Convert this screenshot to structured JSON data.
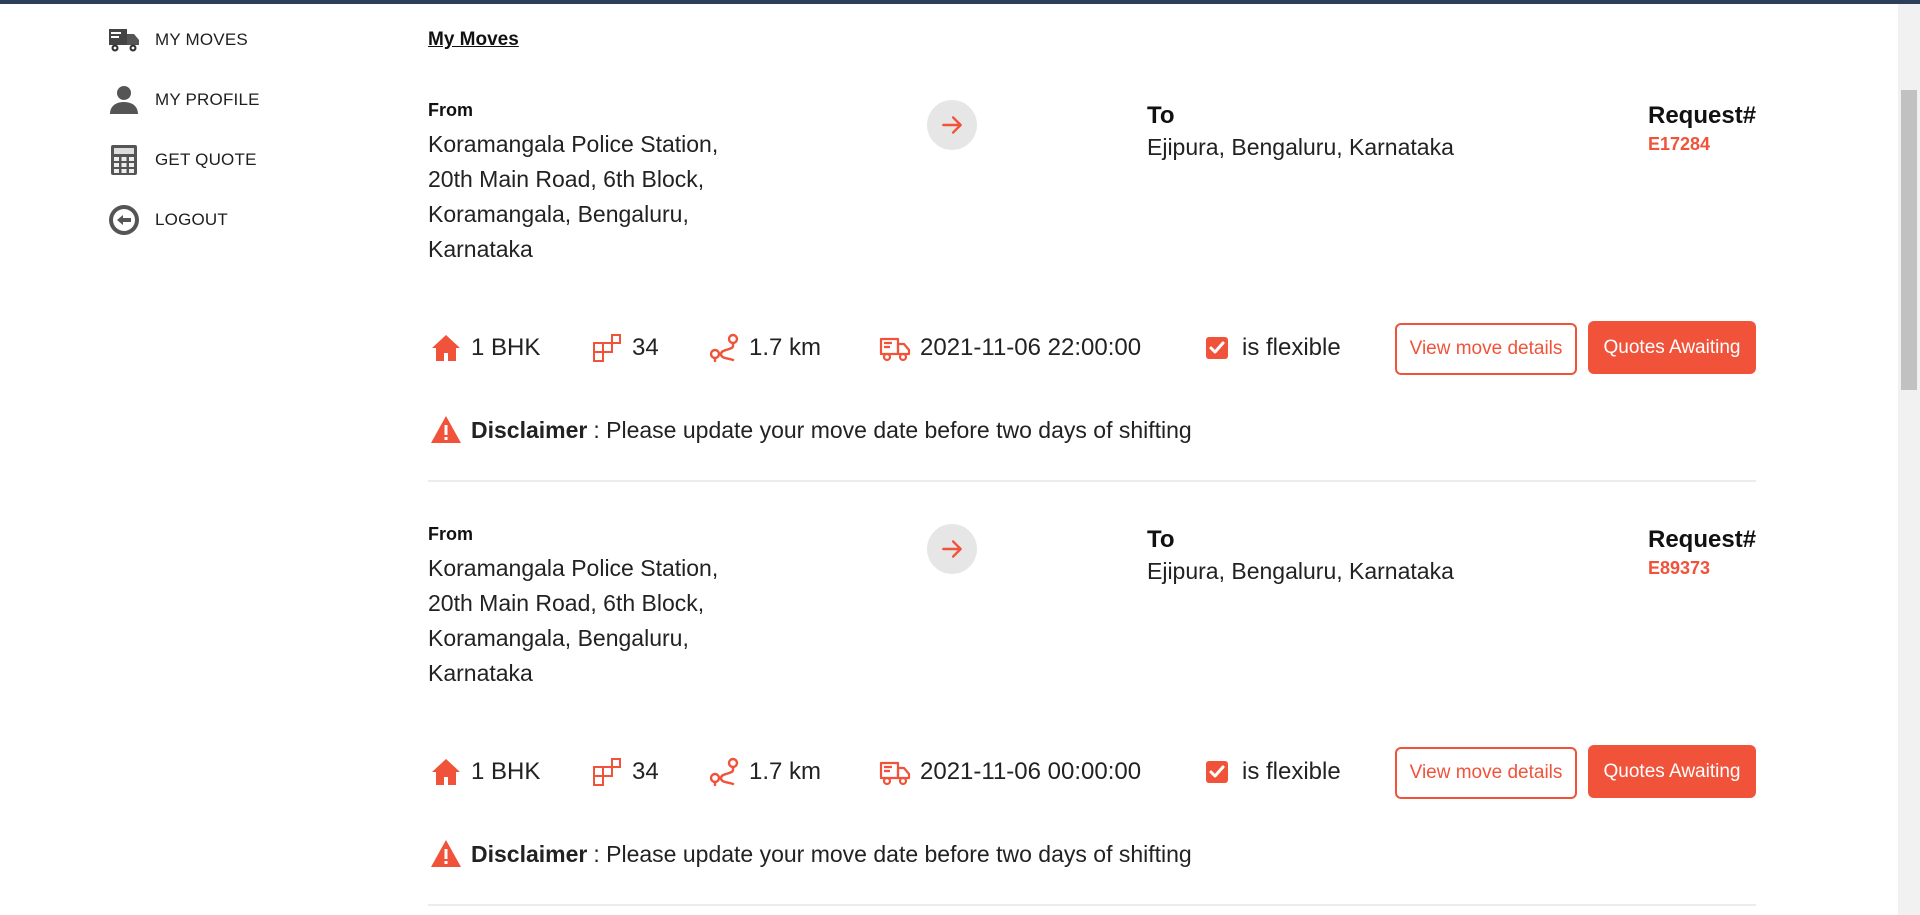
{
  "sidebar": {
    "items": [
      {
        "label": "MY MOVES",
        "icon": "truck-icon"
      },
      {
        "label": "MY PROFILE",
        "icon": "user-icon"
      },
      {
        "label": "GET QUOTE",
        "icon": "calculator-icon"
      },
      {
        "label": "LOGOUT",
        "icon": "logout-icon"
      }
    ]
  },
  "main": {
    "title": "My Moves",
    "moves": [
      {
        "from_label": "From",
        "from_address": [
          "Koramangala Police Station,",
          "20th Main Road, 6th Block,",
          "Koramangala, Bengaluru,",
          "Karnataka"
        ],
        "to_label": "To",
        "to_address": "Ejipura, Bengaluru, Karnataka",
        "request_label": "Request#",
        "request_id": "E17284",
        "house_type": "1 BHK",
        "items_count": "34",
        "distance": "1.7 km",
        "move_datetime": "2021-11-06 22:00:00",
        "flexible_label": "is flexible",
        "view_button": "View move details",
        "status_button": "Quotes Awaiting",
        "disclaimer_title": "Disclaimer",
        "disclaimer_text": ": Please update your move date before two days of shifting"
      },
      {
        "from_label": "From",
        "from_address": [
          "Koramangala Police Station,",
          "20th Main Road, 6th Block,",
          "Koramangala, Bengaluru,",
          "Karnataka"
        ],
        "to_label": "To",
        "to_address": "Ejipura, Bengaluru, Karnataka",
        "request_label": "Request#",
        "request_id": "E89373",
        "house_type": "1 BHK",
        "items_count": "34",
        "distance": "1.7 km",
        "move_datetime": "2021-11-06 00:00:00",
        "flexible_label": "is flexible",
        "view_button": "View move details",
        "status_button": "Quotes Awaiting",
        "disclaimer_title": "Disclaimer",
        "disclaimer_text": ": Please update your move date before two days of shifting"
      }
    ]
  },
  "colors": {
    "accent": "#f0533a",
    "top_bar": "#2c3e5a",
    "divider": "#ececec"
  }
}
